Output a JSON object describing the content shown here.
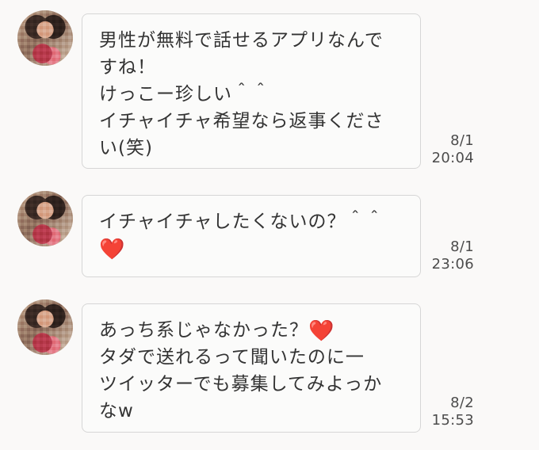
{
  "messages": [
    {
      "lines": [
        "男性が無料で話せるアプリなんで",
        "すね！",
        "けっこー珍しい＾＾",
        "イチャイチャ希望なら返事くださ",
        "い(笑)"
      ],
      "date": "8/1",
      "time": "20:04"
    },
    {
      "line1": "イチャイチャしたくないの？＾＾",
      "heart": "❤️",
      "date": "8/1",
      "time": "23:06"
    },
    {
      "line1": "あっち系じゃなかった？",
      "heart": "❤️",
      "lines": [
        "タダで送れるって聞いたのに一",
        "ツイッターでも募集してみよっか",
        "なw"
      ],
      "date": "8/2",
      "time": "15:53"
    }
  ],
  "avatar_icon": "user-avatar-icon",
  "colors": {
    "background": "#faf9f8",
    "bubble_border": "#d6d6d6",
    "text": "#333333",
    "time": "#4c4c4c",
    "heart": "#e22a2a"
  }
}
